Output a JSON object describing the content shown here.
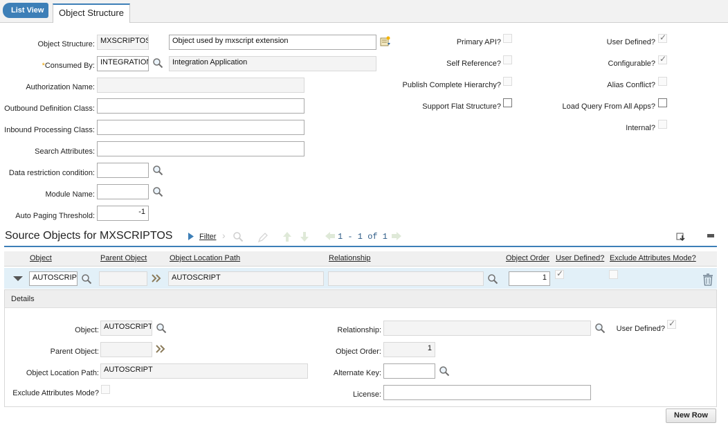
{
  "header": {
    "list_view": "List View",
    "tab": "Object Structure"
  },
  "main": {
    "object_structure": {
      "label": "Object Structure:",
      "value": "MXSCRIPTOS",
      "description": "Object used by mxscript extension"
    },
    "consumed_by": {
      "label": "Consumed By:",
      "value": "INTEGRATION",
      "description": "Integration Application"
    },
    "authorization_name": {
      "label": "Authorization Name:",
      "value": ""
    },
    "outbound_class": {
      "label": "Outbound Definition Class:",
      "value": ""
    },
    "inbound_class": {
      "label": "Inbound Processing Class:",
      "value": ""
    },
    "search_attributes": {
      "label": "Search Attributes:",
      "value": ""
    },
    "data_restriction": {
      "label": "Data restriction condition:",
      "value": ""
    },
    "module_name": {
      "label": "Module Name:",
      "value": ""
    },
    "auto_paging": {
      "label": "Auto Paging Threshold:",
      "value": "-1"
    }
  },
  "flags_mid": [
    {
      "label": "Primary API?",
      "checked": false
    },
    {
      "label": "Self Reference?",
      "checked": false
    },
    {
      "label": "Publish Complete Hierarchy?",
      "checked": false
    },
    {
      "label": "Support Flat Structure?",
      "checked": false
    }
  ],
  "flags_right": [
    {
      "label": "User Defined?",
      "checked": true
    },
    {
      "label": "Configurable?",
      "checked": true
    },
    {
      "label": "Alias Conflict?",
      "checked": false
    },
    {
      "label": "Load Query From All Apps?",
      "checked": false
    },
    {
      "label": "Internal?",
      "checked": false
    }
  ],
  "source": {
    "title": "Source Objects for MXSCRIPTOS",
    "filter": "Filter",
    "paging": "1 - 1 of 1",
    "columns": [
      "Object",
      "Parent Object",
      "Object Location Path",
      "Relationship",
      "Object Order",
      "User Defined?",
      "Exclude Attributes Mode?"
    ],
    "row": {
      "object": "AUTOSCRIPT",
      "parent": "",
      "path": "AUTOSCRIPT",
      "relationship": "",
      "order": "1",
      "user_defined": true,
      "exclude": false
    }
  },
  "details": {
    "title": "Details",
    "object": {
      "label": "Object:",
      "value": "AUTOSCRIPT"
    },
    "parent_object": {
      "label": "Parent Object:",
      "value": ""
    },
    "location_path": {
      "label": "Object Location Path:",
      "value": "AUTOSCRIPT"
    },
    "exclude_mode": {
      "label": "Exclude Attributes Mode?",
      "checked": false
    },
    "relationship": {
      "label": "Relationship:",
      "value": ""
    },
    "user_defined": {
      "label": "User Defined?",
      "checked": true
    },
    "object_order": {
      "label": "Object Order:",
      "value": "1"
    },
    "alternate_key": {
      "label": "Alternate Key:",
      "value": ""
    },
    "license": {
      "label": "License:",
      "value": ""
    }
  },
  "new_row": "New Row",
  "colors": {
    "accent": "#3d7fb7",
    "selected_row": "#e2f0f8"
  }
}
